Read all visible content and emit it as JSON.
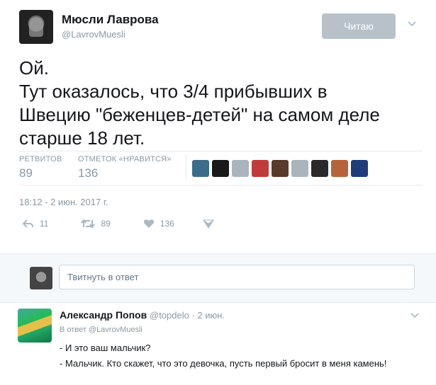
{
  "tweet": {
    "author_name": "Мюсли Лаврова",
    "author_handle": "@LavrovMuesli",
    "follow_label": "Читаю",
    "text_lines": [
      "Ой.",
      "Тут оказалось, что 3/4 прибывших в",
      "Швецию \"беженцев-детей\" на самом деле",
      "старше 18 лет."
    ],
    "retweets_label": "РЕТВИТОВ",
    "retweets_count": "89",
    "likes_label": "ОТМЕТОК «НРАВИТСЯ»",
    "likes_count": "136",
    "timestamp": "18:12 - 2 июн. 2017 г.",
    "actions": {
      "reply_count": "11",
      "retweet_count": "89",
      "like_count": "136"
    },
    "liker_avatar_colors": [
      "#3b6e8a",
      "#1a1a1a",
      "#aab4bd",
      "#c23b3b",
      "#5a3a2a",
      "#aab4bd",
      "#2a2a2a",
      "#b5643a",
      "#1f3c7a"
    ]
  },
  "reply_box": {
    "placeholder": "Твитнуть в ответ"
  },
  "reply": {
    "author_name": "Александр Попов",
    "author_handle": "@topdelo",
    "separator": "·",
    "date": "2 июн.",
    "in_reply_prefix": "В ответ",
    "in_reply_handle": "@LavrovMuesli",
    "text_lines": [
      "- И это ваш мальчик?",
      "- Мальчик. Кто скажет, что это девочка,  пусть первый бросит в меня камень!"
    ]
  },
  "colors": {
    "muted": "#8899a6",
    "follow_bg": "#b8c1ca",
    "divider": "#e6ecf0"
  }
}
